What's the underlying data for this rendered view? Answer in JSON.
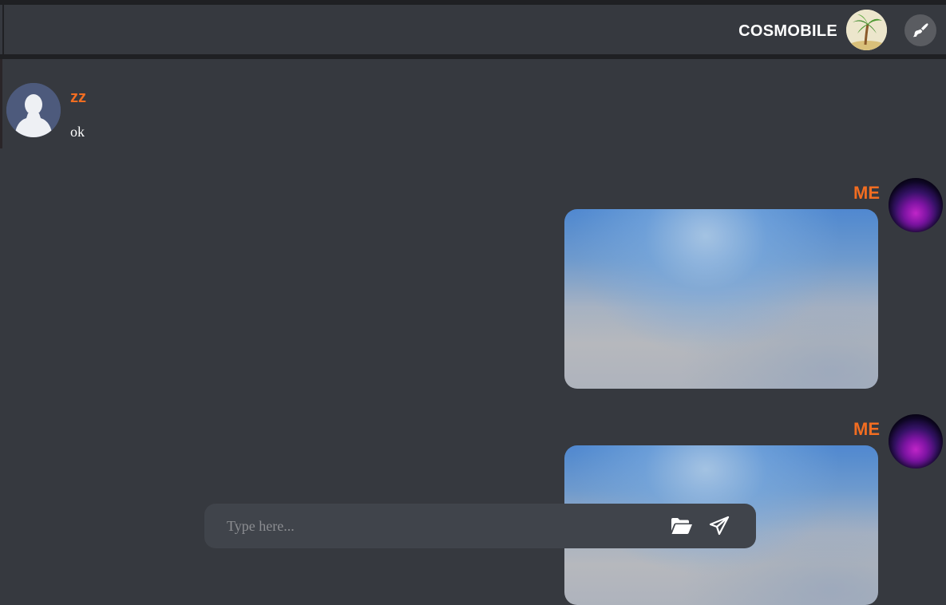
{
  "header": {
    "brand": "COSMOBILE",
    "avatar_icon": "palm-tree-island-icon",
    "brush_icon": "paintbrush-icon"
  },
  "messages": [
    {
      "author": "zz",
      "text": "ok",
      "side": "left",
      "avatar_icon": "default-user-icon"
    },
    {
      "author": "ME",
      "type": "image",
      "side": "right",
      "avatar_icon": "galaxy-avatar"
    },
    {
      "author": "ME",
      "type": "image",
      "side": "right",
      "avatar_icon": "galaxy-avatar"
    }
  ],
  "composer": {
    "placeholder": "Type here...",
    "attach_icon": "folder-open-icon",
    "send_icon": "paper-plane-icon"
  },
  "colors": {
    "background": "#36393f",
    "header_border": "#1f2023",
    "username_accent": "#f26d21",
    "composer_bg": "#40444b"
  }
}
